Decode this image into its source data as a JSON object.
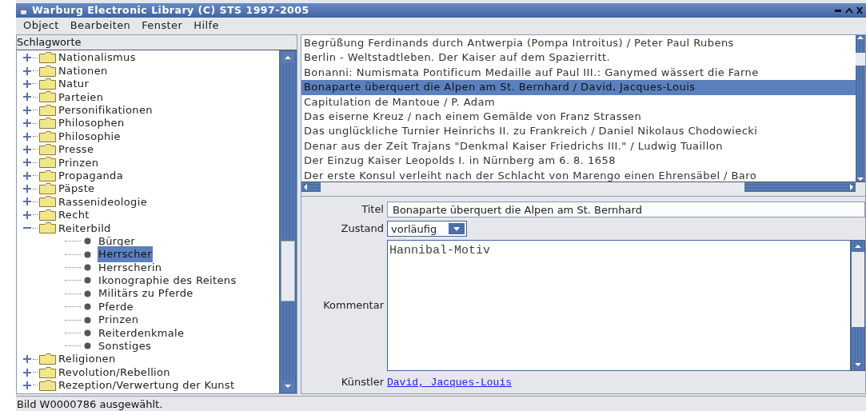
{
  "window": {
    "title": "Warburg Electronic Library (C) STS 1997-2005"
  },
  "menu": [
    "Object",
    "Bearbeiten",
    "Fenster",
    "Hilfe"
  ],
  "tree": {
    "title": "Schlagworte",
    "items": [
      {
        "label": "Nationalismus",
        "expanded": false,
        "selected": false
      },
      {
        "label": "Nationen",
        "expanded": false,
        "selected": false
      },
      {
        "label": "Natur",
        "expanded": false,
        "selected": false
      },
      {
        "label": "Parteien",
        "expanded": false,
        "selected": false
      },
      {
        "label": "Personifikationen",
        "expanded": false,
        "selected": false
      },
      {
        "label": "Philosophen",
        "expanded": false,
        "selected": false
      },
      {
        "label": "Philosophie",
        "expanded": false,
        "selected": false
      },
      {
        "label": "Presse",
        "expanded": false,
        "selected": false
      },
      {
        "label": "Prinzen",
        "expanded": false,
        "selected": false
      },
      {
        "label": "Propaganda",
        "expanded": false,
        "selected": false
      },
      {
        "label": "Päpste",
        "expanded": false,
        "selected": false
      },
      {
        "label": "Rassenideologie",
        "expanded": false,
        "selected": false
      },
      {
        "label": "Recht",
        "expanded": false,
        "selected": false
      },
      {
        "label": "Reiterbild",
        "expanded": true,
        "selected": false,
        "children": [
          {
            "label": "Bürger",
            "selected": false
          },
          {
            "label": "Herrscher",
            "selected": true
          },
          {
            "label": "Herrscherin",
            "selected": false
          },
          {
            "label": "Ikonographie des Reitens",
            "selected": false
          },
          {
            "label": "Militärs zu Pferde",
            "selected": false
          },
          {
            "label": "Pferde",
            "selected": false
          },
          {
            "label": "Prinzen",
            "selected": false
          },
          {
            "label": "Reiterdenkmale",
            "selected": false
          },
          {
            "label": "Sonstiges",
            "selected": false
          }
        ]
      },
      {
        "label": "Religionen",
        "expanded": false,
        "selected": false
      },
      {
        "label": "Revolution/Rebellion",
        "expanded": false,
        "selected": false
      },
      {
        "label": "Rezeption/Verwertung der Kunst",
        "expanded": false,
        "selected": false
      }
    ]
  },
  "list": {
    "rows": [
      {
        "text": "Begrüßung Ferdinands durch Antwerpia (Pompa Introitus) / Peter Paul Rubens",
        "selected": false
      },
      {
        "text": "Berlin - Weltstadtleben. Der Kaiser auf dem Spazierritt.",
        "selected": false
      },
      {
        "text": "Bonanni: Numismata Pontificum Medaille auf Paul III.: Ganymed wässert die Farne",
        "selected": false
      },
      {
        "text": "Bonaparte überquert die Alpen am St. Bernhard / David, Jacques-Louis",
        "selected": true
      },
      {
        "text": "Capitulation de Mantoue / P. Adam",
        "selected": false
      },
      {
        "text": "Das eiserne Kreuz / nach einem Gemälde von Franz Strassen",
        "selected": false
      },
      {
        "text": "Das unglückliche Turnier Heinrichs II. zu Frankreich / Daniel Nikolaus Chodowiecki",
        "selected": false
      },
      {
        "text": "Denar aus der Zeit Trajans \"Denkmal Kaiser Friedrichs III.\" / Ludwig Tuaillon",
        "selected": false
      },
      {
        "text": "Der Einzug Kaiser Leopolds I. in Nürnberg am 6. 8. 1658",
        "selected": false
      },
      {
        "text": "Der erste Konsul verleiht nach der Schlacht von Marengo einen Ehrensäbel / Baro",
        "selected": false
      }
    ]
  },
  "form": {
    "title_label": "Titel",
    "title_value": "Bonaparte überquert die Alpen am St. Bernhard",
    "state_label": "Zustand",
    "state_value": "vorläufig",
    "comment_label": "Kommentar",
    "comment_value": "Hannibal-Motiv",
    "artist_label": "Künstler",
    "artist_value": "David, Jacques-Louis"
  },
  "status_bar": "Bild W0000786 ausgewählt."
}
